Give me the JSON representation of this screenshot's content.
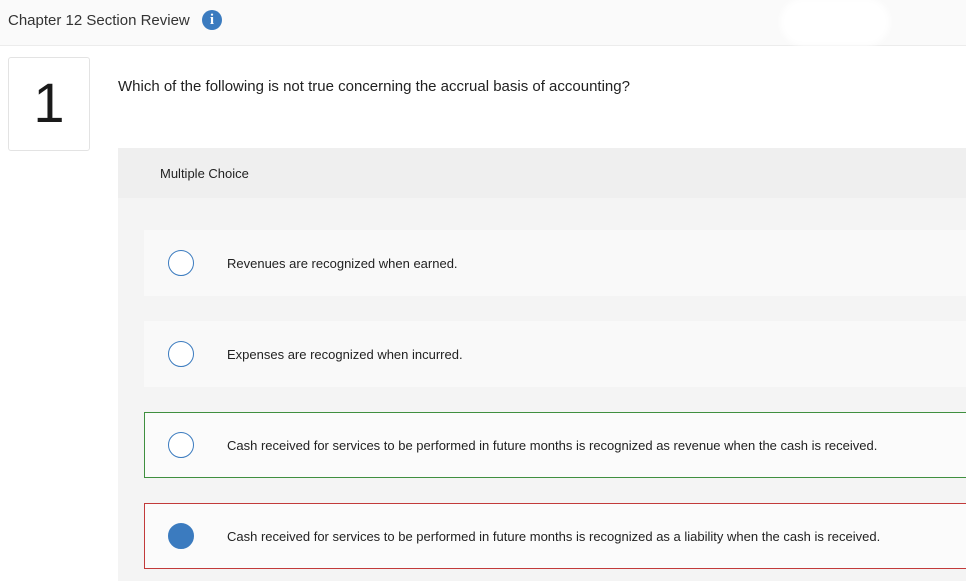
{
  "header": {
    "title": "Chapter 12 Section Review",
    "info_icon": "i"
  },
  "question": {
    "number": "1",
    "text": "Which of the following is not true concerning the accrual basis of accounting?"
  },
  "multiple_choice": {
    "label": "Multiple Choice",
    "options": [
      {
        "text": "Revenues are recognized when earned.",
        "selected": false,
        "status": "none"
      },
      {
        "text": "Expenses are recognized when incurred.",
        "selected": false,
        "status": "none"
      },
      {
        "text": "Cash received for services to be performed in future months is recognized as revenue when the cash is received.",
        "selected": false,
        "status": "correct"
      },
      {
        "text": "Cash received for services to be performed in future months is recognized as a liability when the cash is received.",
        "selected": true,
        "status": "incorrect"
      }
    ]
  },
  "colors": {
    "accent": "#3b7bbf",
    "correct_border": "#3f8f3f",
    "incorrect_border": "#c23a3a"
  }
}
